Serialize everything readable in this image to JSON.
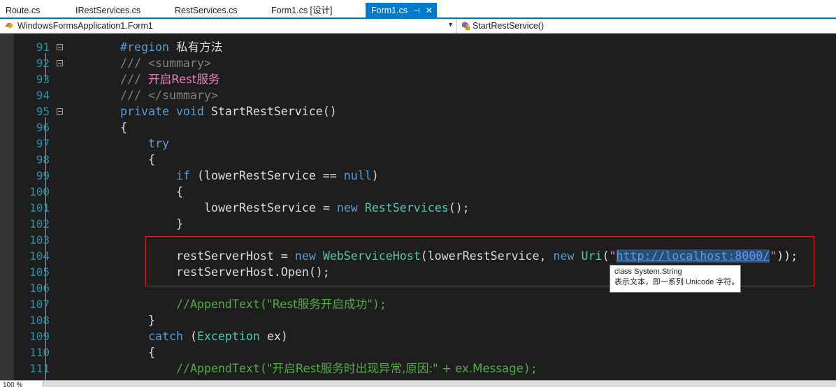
{
  "tabs": [
    {
      "label": "Route.cs"
    },
    {
      "label": "IRestServices.cs"
    },
    {
      "label": "RestServices.cs"
    },
    {
      "label": "Form1.cs [设计]"
    },
    {
      "label": "Form1.cs",
      "active": true
    }
  ],
  "tab_icons": {
    "pin": "⊣",
    "close": "✕"
  },
  "nav": {
    "class_dropdown": "WindowsFormsApplication1.Form1",
    "member_dropdown": "StartRestService()"
  },
  "line_numbers": [
    "91",
    "92",
    "93",
    "94",
    "95",
    "96",
    "97",
    "98",
    "99",
    "100",
    "101",
    "102",
    "103",
    "104",
    "105",
    "106",
    "107",
    "108",
    "109",
    "110",
    "111"
  ],
  "code": {
    "l91": {
      "kw": "#region",
      "text": "私有方法"
    },
    "l92": {
      "slashes": "///",
      "tag": "<summary>"
    },
    "l93": {
      "slashes": "///",
      "text": "开启Rest服务"
    },
    "l94": {
      "slashes": "///",
      "tag": "</summary>"
    },
    "l95": {
      "kw1": "private",
      "kw2": "void",
      "name": "StartRestService",
      "rest": "()"
    },
    "l96": "{",
    "l97": "try",
    "l98": "{",
    "l99": {
      "kw": "if",
      "a": " (lowerRestService == ",
      "nul": "null",
      "b": ")"
    },
    "l100": "{",
    "l101": {
      "a": "lowerRestService = ",
      "kw": "new",
      "ty": "RestServices",
      "b": "();"
    },
    "l102": "}",
    "l104": {
      "a": "restServerHost = ",
      "kw1": "new",
      "ty1": "WebServiceHost",
      "b": "(lowerRestService, ",
      "kw2": "new",
      "ty2": "Uri",
      "c": "(",
      "q1": "\"",
      "url": "http://localhost:8000/",
      "q2": "\"",
      "d": "));"
    },
    "l105": "restServerHost.Open();",
    "l107": {
      "c1": "//AppendText(",
      "c2": "\"Rest服务开启成功\"",
      "c3": ");"
    },
    "l108": "}",
    "l109": {
      "kw": "catch",
      "a": " (",
      "ty": "Exception",
      "b": " ex)"
    },
    "l110": "{",
    "l111": {
      "c1": "//AppendText(",
      "c2": "\"开启Rest服务时出现异常,原因:\" + ex.Message",
      "c3": ");"
    }
  },
  "tooltip": {
    "line1": "class System.String",
    "line2": "表示文本，即一系列 Unicode 字符。"
  },
  "status": {
    "zoom": "100 %"
  }
}
